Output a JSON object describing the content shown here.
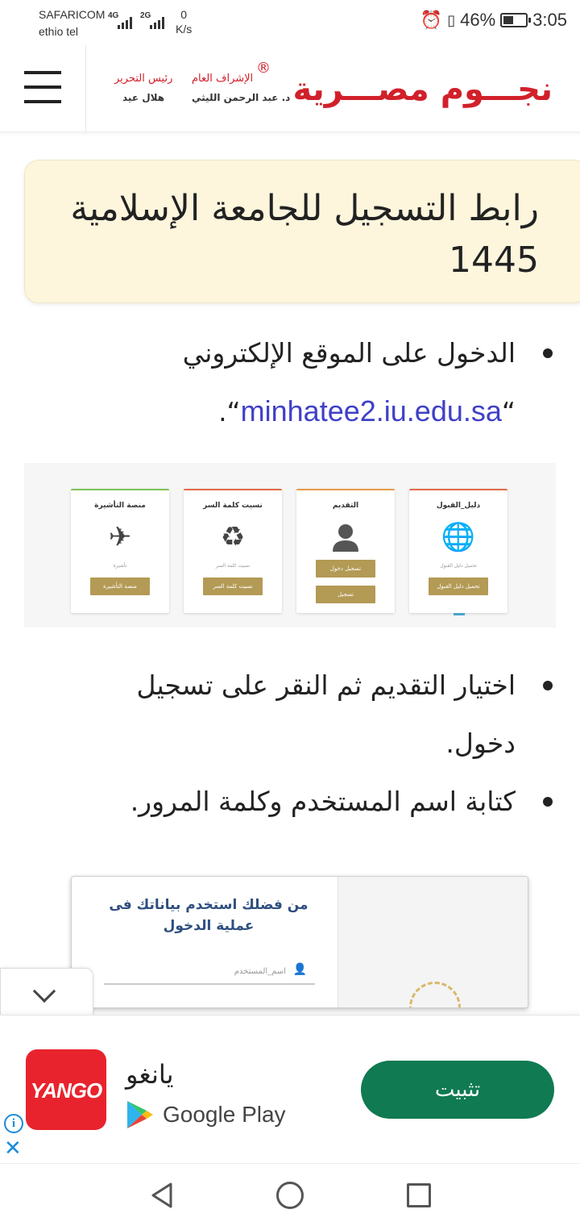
{
  "status_bar": {
    "carrier1": "SAFARICOM",
    "carrier2": "ethio tel",
    "net1": "4G",
    "net2": "2G",
    "speed_value": "0",
    "speed_unit": "K/s",
    "battery": "46%",
    "time": "3:05",
    "battery_level": 0.46,
    "icons": [
      "alarm-icon",
      "vibrate-icon",
      "battery-icon"
    ]
  },
  "header": {
    "logo_main": "نجـــوم مصـــرية",
    "logo_reg": "®",
    "supervisor_title": "الإشراف العام",
    "supervisor_name": "د. عبد الرحمن الليثي",
    "editor_title": "رئيس التحرير",
    "editor_name": "هلال عيد",
    "brand_color": "#d1202a"
  },
  "article": {
    "title": "رابط التسجيل للجامعة الإسلامية 1445",
    "bullet1_text": "الدخول على الموقع الإلكتروني",
    "bullet1_link": "minhatee2.iu.edu.sa",
    "bullet2_line1": "اختيار التقديم ثم النقر على تسجيل",
    "bullet2_line2": "دخول.",
    "bullet3": "كتابة اسم المستخدم وكلمة المرور."
  },
  "image1": {
    "cards": [
      {
        "title": "دليل_القبول",
        "icon": "globe-icon",
        "sub": "تحميل دليل القبول",
        "buttons": [
          "تحميل دليل القبول"
        ]
      },
      {
        "title": "التقديم",
        "icon": "user-icon",
        "sub": "",
        "buttons": [
          "تسجيل دخول",
          "تسجيل"
        ]
      },
      {
        "title": "نسيت كلمة السر",
        "icon": "recycle-icon",
        "sub": "نسيت كلمة السر",
        "buttons": [
          "نسيت كلمة السر"
        ]
      },
      {
        "title": "منصة التأشيرة",
        "icon": "plane-icon",
        "sub": "تأشيرة",
        "buttons": [
          "منصة التأشيرة"
        ]
      }
    ]
  },
  "image2": {
    "title": "من فضلك استخدم بياناتك فى عملية الدخول",
    "username_placeholder": "اسم_المستخدم"
  },
  "ad": {
    "app_icon_text": "YANGO",
    "app_name": "يانغو",
    "store": "Google Play",
    "install_label": "تثبيت",
    "button_color": "#107a52"
  }
}
